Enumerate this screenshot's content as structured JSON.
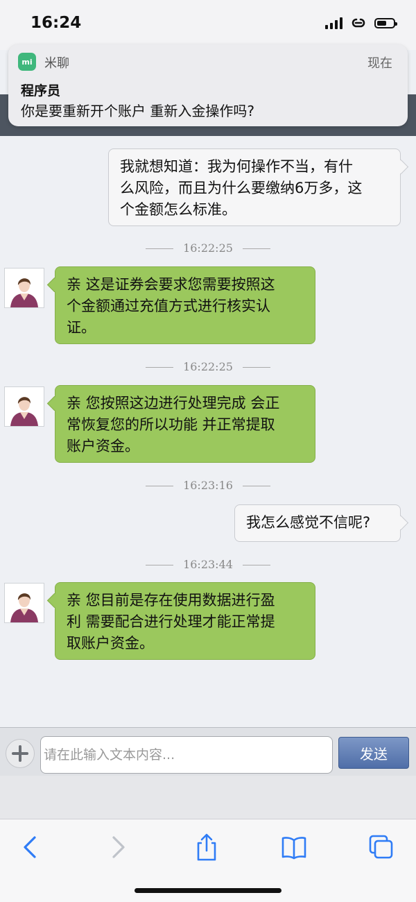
{
  "status_bar": {
    "time": "16:24"
  },
  "notification": {
    "app_icon_text": "mi",
    "app_name": "米聊",
    "time": "现在",
    "title": "程序员",
    "body": "你是要重新开个账户 重新入金操作吗?"
  },
  "chat": {
    "messages": [
      {
        "side": "out",
        "lines": [
          "我就想知道：我为何操作不当，有什",
          "么风险，而且为什么要缴纳6万多，这",
          "个金额怎么标准。"
        ]
      },
      {
        "type": "time",
        "text": "16:22:25"
      },
      {
        "side": "in",
        "lines": [
          "亲 这是证券会要求您需要按照这",
          "个金额通过充值方式进行核实认",
          "证。"
        ]
      },
      {
        "type": "time",
        "text": "16:22:25"
      },
      {
        "side": "in",
        "lines": [
          "亲 您按照这边进行处理完成 会正",
          "常恢复您的所以功能 并正常提取",
          "账户资金。"
        ]
      },
      {
        "type": "time",
        "text": "16:23:16"
      },
      {
        "side": "out",
        "lines": [
          "我怎么感觉不信呢?"
        ]
      },
      {
        "type": "time",
        "text": "16:23:44"
      },
      {
        "side": "in",
        "lines": [
          "亲 您目前是存在使用数据进行盈",
          "利 需要配合进行处理才能正常提",
          "取账户资金。"
        ]
      }
    ]
  },
  "input_bar": {
    "placeholder": "请在此输入文本内容...",
    "send_label": "发送"
  },
  "colors": {
    "incoming_bubble": "#9bc85d",
    "outgoing_bubble": "#f6f6f7",
    "send_button": "#4f6ea8",
    "toolbar_icon": "#2f7cf6"
  }
}
